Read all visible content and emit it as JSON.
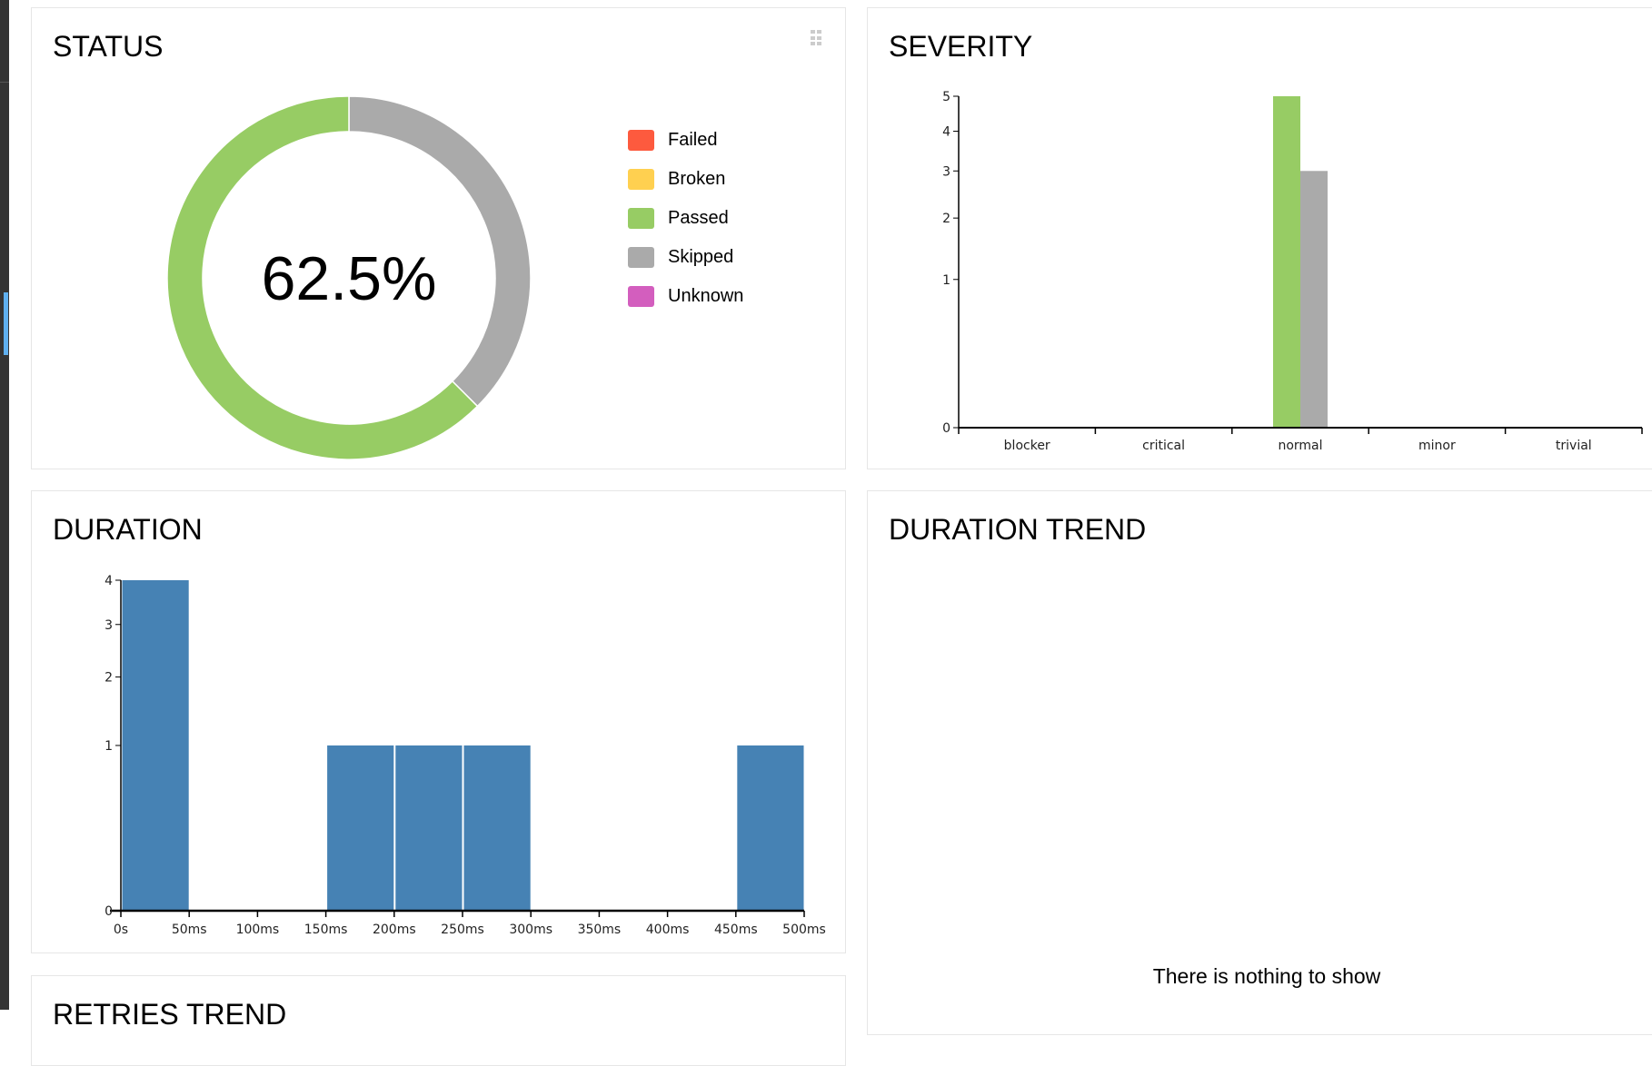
{
  "status": {
    "title": "STATUS",
    "percent_label": "62.5%",
    "legend": [
      {
        "label": "Failed",
        "color": "#fd5a3e"
      },
      {
        "label": "Broken",
        "color": "#ffd050"
      },
      {
        "label": "Passed",
        "color": "#97cc64"
      },
      {
        "label": "Skipped",
        "color": "#aaaaaa"
      },
      {
        "label": "Unknown",
        "color": "#d35ebe"
      }
    ]
  },
  "severity": {
    "title": "SEVERITY"
  },
  "duration": {
    "title": "DURATION"
  },
  "duration_trend": {
    "title": "DURATION TREND",
    "empty_message": "There is nothing to show"
  },
  "retries_trend": {
    "title": "RETRIES TREND"
  },
  "chart_data": [
    {
      "type": "pie",
      "donut": true,
      "categories": [
        "Failed",
        "Broken",
        "Passed",
        "Skipped",
        "Unknown"
      ],
      "values": [
        0,
        0,
        5,
        3,
        0
      ],
      "colors": [
        "#fd5a3e",
        "#ffd050",
        "#97cc64",
        "#aaaaaa",
        "#d35ebe"
      ],
      "center_label": "62.5%"
    },
    {
      "type": "bar",
      "title": "SEVERITY",
      "categories": [
        "blocker",
        "critical",
        "normal",
        "minor",
        "trivial"
      ],
      "series": [
        {
          "status": "passed",
          "color": "#97cc64",
          "values": [
            0,
            0,
            5,
            0,
            0
          ]
        },
        {
          "status": "skipped",
          "color": "#aaaaaa",
          "values": [
            0,
            0,
            3,
            0,
            0
          ]
        }
      ],
      "yscale": "sqrt",
      "ylim": [
        0,
        5
      ],
      "yticks": [
        0,
        1,
        2,
        3,
        4,
        5
      ]
    },
    {
      "type": "bar",
      "title": "DURATION",
      "bins": [
        [
          0,
          50
        ],
        [
          50,
          100
        ],
        [
          100,
          150
        ],
        [
          150,
          200
        ],
        [
          200,
          250
        ],
        [
          250,
          300
        ],
        [
          300,
          350
        ],
        [
          350,
          400
        ],
        [
          400,
          450
        ],
        [
          450,
          500
        ]
      ],
      "values": [
        4,
        0,
        0,
        1,
        1,
        1,
        0,
        0,
        0,
        1
      ],
      "color": "#4682b4",
      "xticks": [
        "0s",
        "50ms",
        "100ms",
        "150ms",
        "200ms",
        "250ms",
        "300ms",
        "350ms",
        "400ms",
        "450ms",
        "500ms"
      ],
      "yscale": "sqrt",
      "ylim": [
        0,
        4
      ],
      "yticks": [
        0,
        1,
        2,
        3,
        4
      ]
    }
  ]
}
